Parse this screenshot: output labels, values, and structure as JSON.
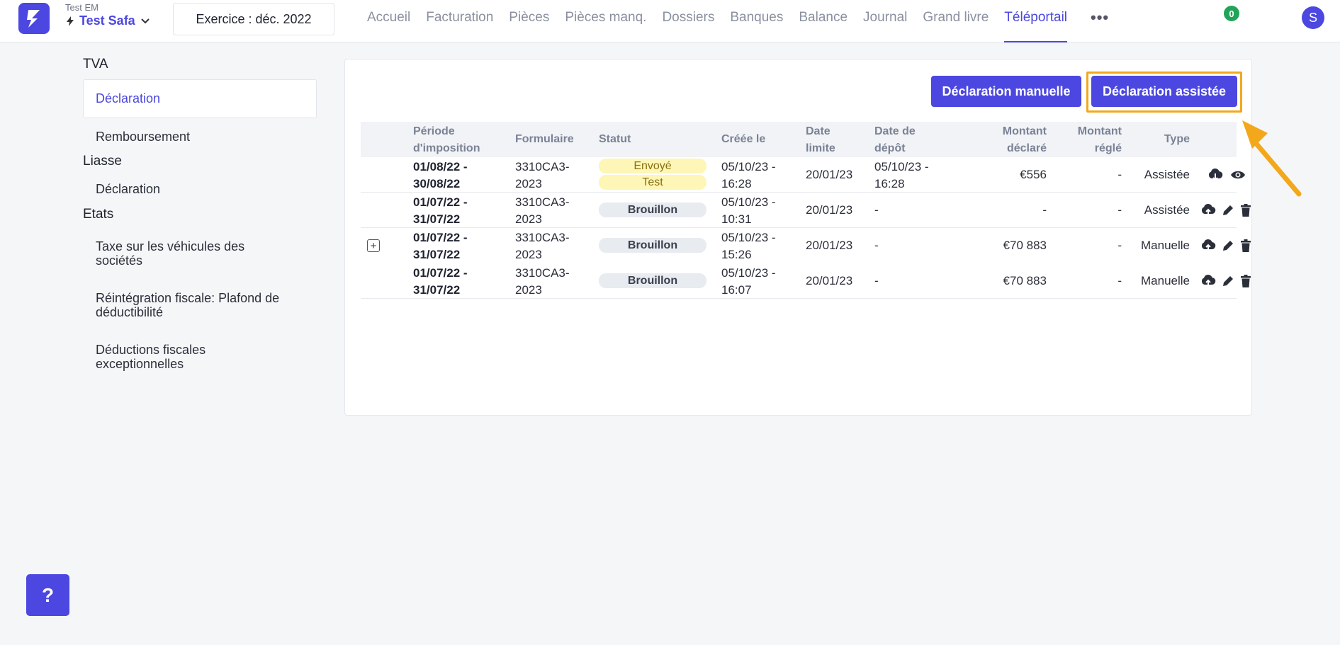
{
  "header": {
    "company_sub": "Test EM",
    "company_name": "Test Safa",
    "exercise": "Exercice : déc. 2022",
    "nav": [
      "Accueil",
      "Facturation",
      "Pièces",
      "Pièces manq.",
      "Dossiers",
      "Banques",
      "Balance",
      "Journal",
      "Grand livre",
      "Téléportail"
    ],
    "active_nav": "Téléportail",
    "more": "•••",
    "notification_count": "0",
    "avatar_letter": "S"
  },
  "sidebar": {
    "tva_title": "TVA",
    "tva_items": [
      "Déclaration",
      "Remboursement"
    ],
    "liasse_title": "Liasse",
    "liasse_items": [
      "Déclaration"
    ],
    "etats_title": "Etats",
    "etats_items": [
      "Taxe sur les véhicules des sociétés",
      "Réintégration fiscale: Plafond de déductibilité",
      "Déductions fiscales exceptionnelles"
    ]
  },
  "actions": {
    "manual": "Déclaration manuelle",
    "assisted": "Déclaration assistée"
  },
  "table": {
    "headers": {
      "periode": "Période d'imposition",
      "formulaire": "Formulaire",
      "statut": "Statut",
      "creee": "Créée le",
      "limite": "Date limite",
      "depot": "Date de dépôt",
      "declare": "Montant déclaré",
      "regle": "Montant réglé",
      "type": "Type"
    },
    "rows": [
      {
        "periode": "01/08/22 - 30/08/22",
        "formulaire": "3310CA3-2023",
        "statut": "Envoyé",
        "statut2": "Test",
        "creee": "05/10/23 - 16:28",
        "limite": "20/01/23",
        "depot": "05/10/23 - 16:28",
        "declare": "€556",
        "regle": "-",
        "type": "Assistée",
        "actions": [
          "cloud-download-icon",
          "eye-icon"
        ]
      },
      {
        "periode": "01/07/22 - 31/07/22",
        "formulaire": "3310CA3-2023",
        "statut": "Brouillon",
        "creee": "05/10/23 - 10:31",
        "limite": "20/01/23",
        "depot": "-",
        "declare": "-",
        "regle": "-",
        "type": "Assistée",
        "actions": [
          "cloud-upload-icon",
          "pencil-icon",
          "trash-icon"
        ]
      },
      {
        "periode": "01/07/22 - 31/07/22",
        "formulaire": "3310CA3-2023",
        "statut": "Brouillon",
        "creee": "05/10/23 - 15:26",
        "limite": "20/01/23",
        "depot": "-",
        "declare": "€70 883",
        "regle": "-",
        "type": "Manuelle",
        "actions": [
          "cloud-upload-icon",
          "pencil-icon",
          "trash-icon"
        ]
      },
      {
        "periode": "01/07/22 - 31/07/22",
        "formulaire": "3310CA3-2023",
        "statut": "Brouillon",
        "creee": "05/10/23 - 16:07",
        "limite": "20/01/23",
        "depot": "-",
        "declare": "€70 883",
        "regle": "-",
        "type": "Manuelle",
        "actions": [
          "cloud-upload-icon",
          "pencil-icon",
          "trash-icon"
        ]
      }
    ]
  },
  "help_label": "?",
  "colors": {
    "accent": "#4b47e0",
    "highlight": "#f3a81b",
    "badge_sent": "#fdf6b6",
    "badge_draft": "#e8ebf0"
  }
}
